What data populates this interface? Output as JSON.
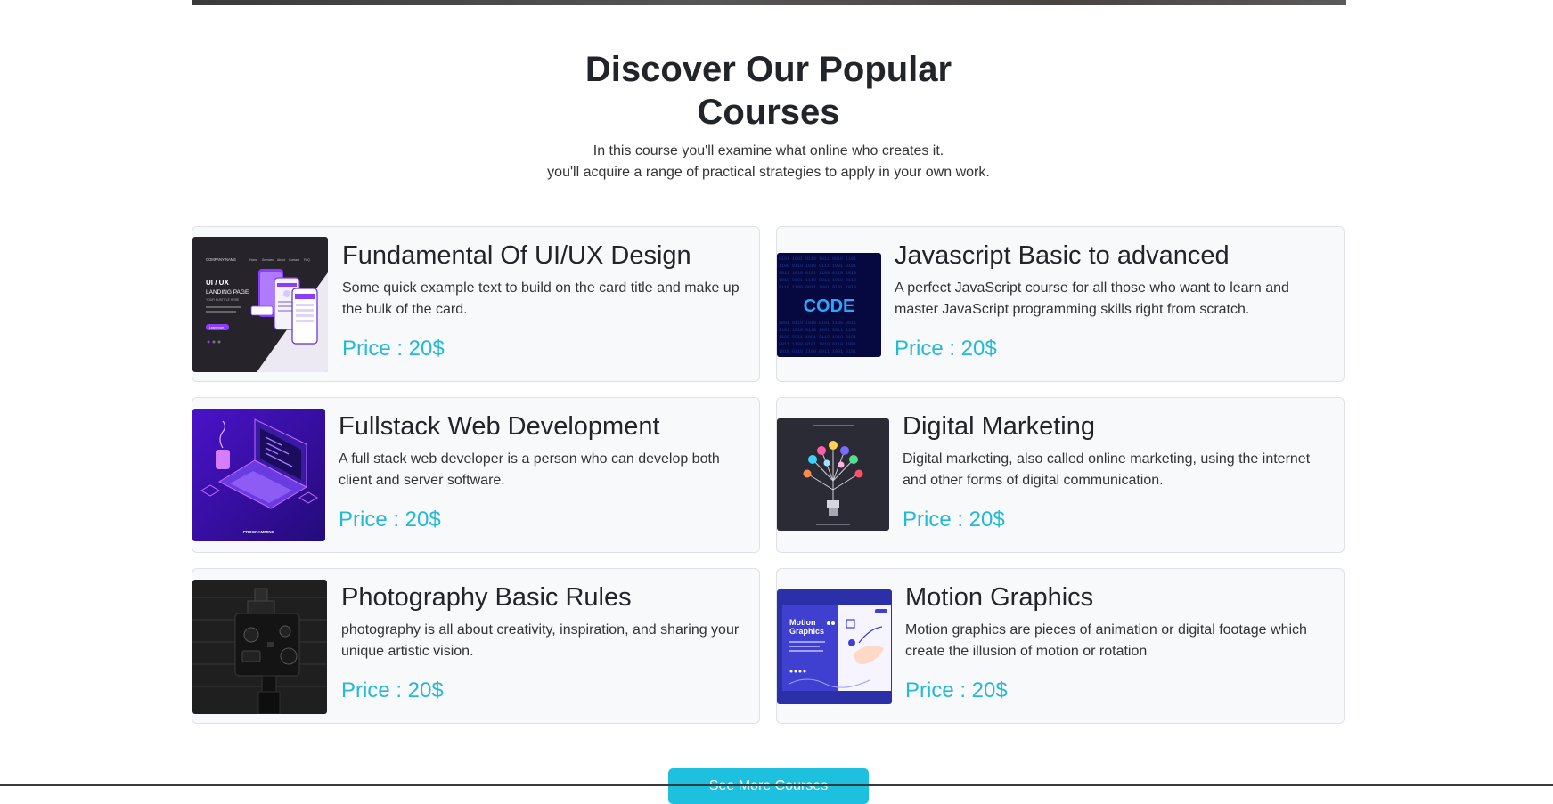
{
  "section": {
    "title_line1": "Discover Our Popular",
    "title_line2": "Courses",
    "subtitle_line1": "In this course you'll examine what online who creates it.",
    "subtitle_line2": "you'll acquire a range of practical strategies to apply in your own work."
  },
  "courses": [
    {
      "title": "Fundamental Of UI/UX Design",
      "description": "Some quick example text to build on the card title and make up the bulk of the card.",
      "price": "Price : 20$",
      "thumbnail": {
        "icon": "ui-ux-landing-page-image",
        "company": "COMPANY NAME",
        "nav": [
          "Home",
          "Services",
          "About",
          "Contact",
          "FAQ"
        ],
        "heading": "UI / UX",
        "subheading": "LANDING PAGE",
        "tagline": "YOUR SUBTITLE HERE",
        "button": "Learn more"
      }
    },
    {
      "title": "Javascript Basic to advanced",
      "description": "A perfect JavaScript course for all those who want to learn and master JavaScript programming skills right from scratch.",
      "price": "Price : 20$",
      "thumbnail": {
        "icon": "code-image",
        "label": "CODE"
      }
    },
    {
      "title": "Fullstack Web Development",
      "description": "A full stack web developer is a person who can develop both client and server software.",
      "price": "Price : 20$",
      "thumbnail": {
        "icon": "laptop-programming-image",
        "label": "PROGRAMMING"
      }
    },
    {
      "title": "Digital Marketing",
      "description": "Digital marketing, also called online marketing, using the internet and other forms of digital communication.",
      "price": "Price : 20$",
      "thumbnail": {
        "icon": "social-tree-image"
      }
    },
    {
      "title": "Photography Basic Rules",
      "description": "photography is all about creativity, inspiration, and sharing your unique artistic vision.",
      "price": "Price : 20$",
      "thumbnail": {
        "icon": "camera-photo-image"
      }
    },
    {
      "title": "Motion Graphics",
      "description": "Motion graphics are pieces of animation or digital footage which create the illusion of motion or rotation",
      "price": "Price : 20$",
      "thumbnail": {
        "icon": "motion-graphics-image",
        "label_line1": "Motion",
        "label_line2": "Graphics"
      }
    }
  ],
  "cta": {
    "label": "See More Courses"
  },
  "colors": {
    "price": "#24b9d6",
    "button": "#1ec0e0",
    "card_bg": "#f8f9fa",
    "card_border": "#dee2e6",
    "text": "#212529"
  }
}
